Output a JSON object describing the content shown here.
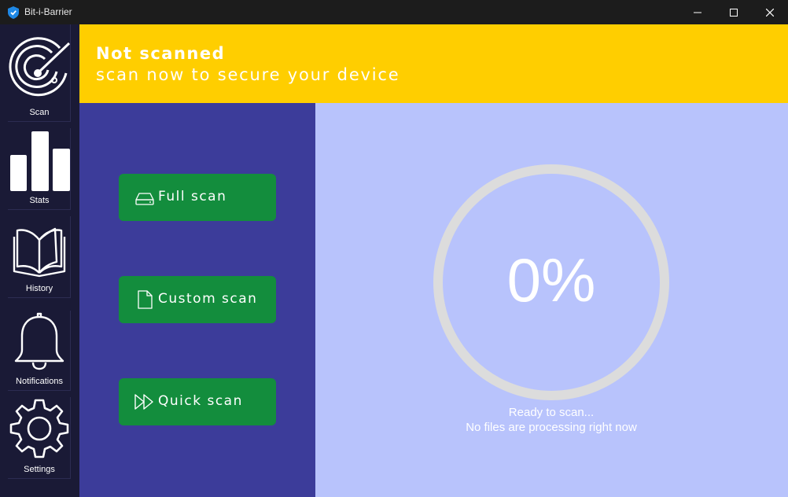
{
  "window": {
    "title": "Bit-i-Barrier",
    "controls": [
      "minimize",
      "maximize",
      "close"
    ]
  },
  "sidebar": {
    "items": [
      {
        "label": "Scan",
        "icon": "radar-icon"
      },
      {
        "label": "Stats",
        "icon": "bar-chart-icon"
      },
      {
        "label": "History",
        "icon": "book-icon"
      },
      {
        "label": "Notifications",
        "icon": "bell-icon"
      },
      {
        "label": "Settings",
        "icon": "gear-icon"
      }
    ]
  },
  "banner": {
    "title": "Not scanned",
    "subtitle": "scan now to secure your device"
  },
  "actions": {
    "full_scan": "Full scan",
    "custom_scan": "Custom scan",
    "quick_scan": "Quick scan"
  },
  "progress": {
    "percent_text": "0%",
    "value": 0,
    "status_line1": "Ready to scan...",
    "status_line2": "No files are processing right now"
  },
  "colors": {
    "banner": "#ffce00",
    "sidebar": "#1a1a36",
    "actions_panel": "#3c3c9a",
    "progress_panel": "#b8c3fc",
    "button": "#138d3d",
    "ring": "#dcdcdc"
  }
}
